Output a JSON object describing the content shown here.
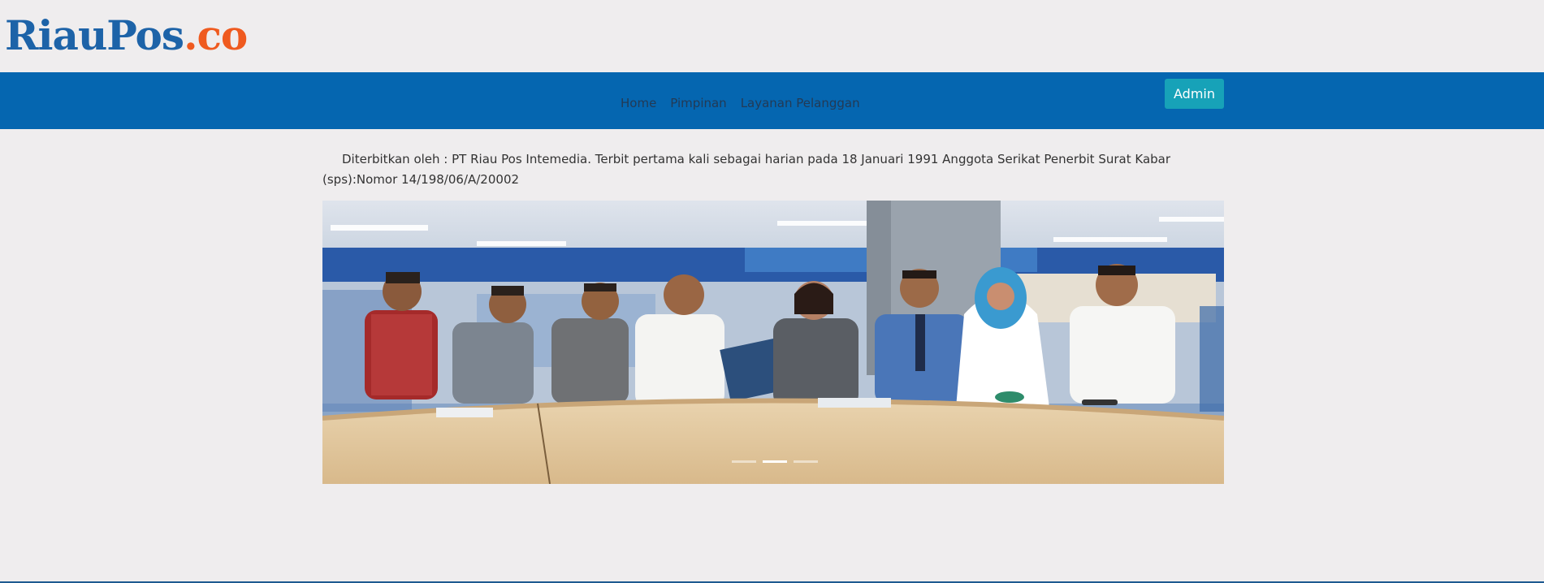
{
  "logo": {
    "part1": "RiauPos",
    "part2": ".co"
  },
  "nav": {
    "links": [
      "Home",
      "Pimpinan",
      "Layanan Pelanggan"
    ],
    "admin_label": "Admin"
  },
  "intro_text": "Diterbitkan oleh : PT Riau Pos Intemedia. Terbit pertama kali sebagai harian pada 18 Januari 1991 Anggota Serikat Penerbit Surat Kabar (sps):Nomor 14/198/06/A/20002",
  "carousel": {
    "active_slide": 2,
    "slide_count": 3
  },
  "colors": {
    "navbar": "#0566b0",
    "logo_primary": "#1d63a8",
    "logo_accent": "#ef5a1f",
    "admin_button": "#17a2b8",
    "page_background": "#efedee"
  }
}
